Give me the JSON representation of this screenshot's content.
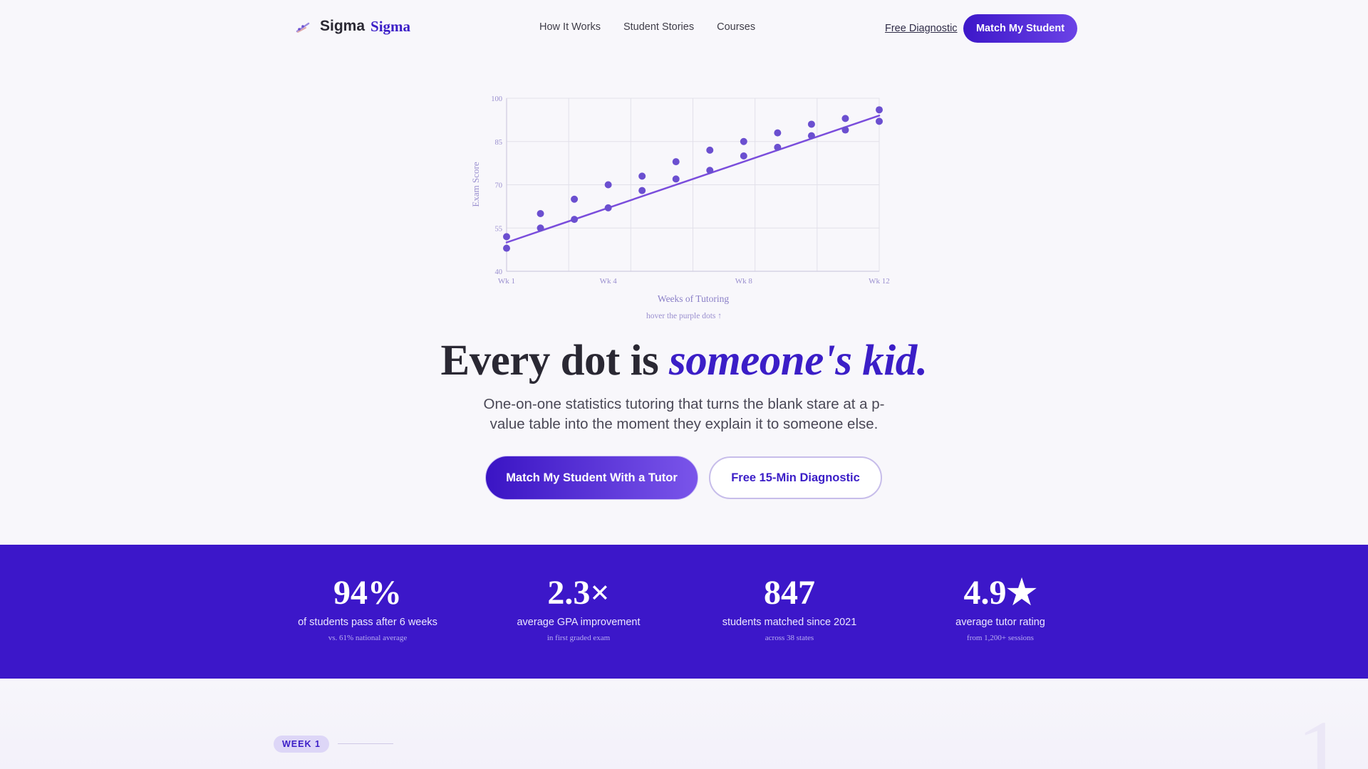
{
  "nav": {
    "brand": {
      "word1": "Sigma",
      "word2": "Sigma"
    },
    "links": [
      "How It Works",
      "Student Stories",
      "Courses"
    ],
    "diagnostic_link": "Free Diagnostic",
    "cta": "Match My Student"
  },
  "chart_data": {
    "type": "scatter",
    "xlabel": "Weeks of Tutoring",
    "ylabel": "Exam Score",
    "xlim": [
      1,
      12
    ],
    "ylim": [
      40,
      100
    ],
    "x_ticks": [
      {
        "value": 1,
        "label": "Wk 1"
      },
      {
        "value": 4,
        "label": "Wk 4"
      },
      {
        "value": 8,
        "label": "Wk 8"
      },
      {
        "value": 12,
        "label": "Wk 12"
      }
    ],
    "y_ticks": [
      40,
      55,
      70,
      85,
      100
    ],
    "grid": true,
    "points": [
      {
        "x": 1,
        "y": 48
      },
      {
        "x": 1,
        "y": 52
      },
      {
        "x": 2,
        "y": 55
      },
      {
        "x": 2,
        "y": 60
      },
      {
        "x": 3,
        "y": 58
      },
      {
        "x": 3,
        "y": 65
      },
      {
        "x": 4,
        "y": 62
      },
      {
        "x": 4,
        "y": 70
      },
      {
        "x": 5,
        "y": 68
      },
      {
        "x": 5,
        "y": 73
      },
      {
        "x": 6,
        "y": 72
      },
      {
        "x": 6,
        "y": 78
      },
      {
        "x": 7,
        "y": 75
      },
      {
        "x": 7,
        "y": 82
      },
      {
        "x": 8,
        "y": 80
      },
      {
        "x": 8,
        "y": 85
      },
      {
        "x": 9,
        "y": 83
      },
      {
        "x": 9,
        "y": 88
      },
      {
        "x": 10,
        "y": 87
      },
      {
        "x": 10,
        "y": 91
      },
      {
        "x": 11,
        "y": 89
      },
      {
        "x": 11,
        "y": 93
      },
      {
        "x": 12,
        "y": 92
      },
      {
        "x": 12,
        "y": 96
      }
    ],
    "trend_line": {
      "from": {
        "x": 1,
        "y": 50
      },
      "to": {
        "x": 12,
        "y": 94
      }
    },
    "hint": "hover the purple dots ↑",
    "colors": {
      "dot": "#6b4fd0",
      "line": "#7a4ddc",
      "axis_text": "#9a8fcf",
      "grid": "#e2e0ea"
    }
  },
  "hero": {
    "title_plain": "Every dot is ",
    "title_highlight": "someone's kid.",
    "subtitle": "One-on-one statistics tutoring that turns the blank stare at a p-value table into the moment they explain it to someone else.",
    "primary_cta": "Match My Student With a Tutor",
    "secondary_cta": "Free 15-Min Diagnostic"
  },
  "stats": [
    {
      "value": "94%",
      "label": "of students pass after 6 weeks",
      "note": "vs. 61% national average"
    },
    {
      "value": "2.3×",
      "label": "average GPA improvement",
      "note": "in first graded exam"
    },
    {
      "value": "847",
      "label": "students matched since 2021",
      "note": "across 38 states"
    },
    {
      "value": "4.9★",
      "label": "average tutor rating",
      "note": "from 1,200+ sessions"
    }
  ],
  "section": {
    "week_badge": "WEEK 1",
    "big_number": "1"
  },
  "colors": {
    "accent": "#3b1ec7",
    "stats_bg": "#3c17c9",
    "page_bg": "#f8f7fb"
  }
}
